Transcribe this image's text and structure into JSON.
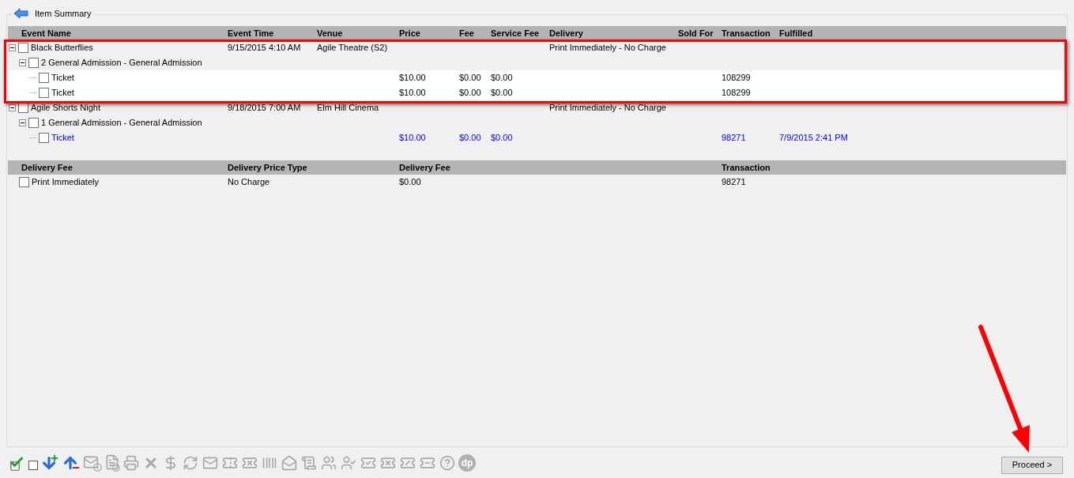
{
  "title": "Item Summary",
  "items_table": {
    "columns": [
      "Event Name",
      "Event Time",
      "Venue",
      "Price",
      "Fee",
      "Service Fee",
      "Delivery",
      "Sold For",
      "Transaction",
      "Fulfilled"
    ],
    "rows": [
      {
        "kind": "event",
        "name": "Black Butterflies",
        "checked": false,
        "expanded": true,
        "event_time": "9/15/2015 4:10 AM",
        "venue": "Agile Theatre (S2)",
        "delivery": "Print Immediately - No Charge",
        "children": [
          {
            "kind": "group",
            "name": "2 General Admission - General Admission",
            "checked": false,
            "expanded": true,
            "children": [
              {
                "kind": "ticket",
                "name": "Ticket",
                "checked": false,
                "fulfilled": false,
                "price": "$10.00",
                "fee": "$0.00",
                "service_fee": "$0.00",
                "transaction": "108299"
              },
              {
                "kind": "ticket",
                "name": "Ticket",
                "checked": false,
                "fulfilled": false,
                "price": "$10.00",
                "fee": "$0.00",
                "service_fee": "$0.00",
                "transaction": "108299"
              }
            ]
          }
        ]
      },
      {
        "kind": "event",
        "name": "Agile Shorts Night",
        "checked": false,
        "expanded": true,
        "event_time": "9/18/2015 7:00 AM",
        "venue": "Elm Hill Cinema",
        "delivery": "Print Immediately - No Charge",
        "children": [
          {
            "kind": "group",
            "name": "1 General Admission - General Admission",
            "checked": false,
            "expanded": true,
            "children": [
              {
                "kind": "ticket",
                "name": "Ticket",
                "checked": false,
                "fulfilled": true,
                "price": "$10.00",
                "fee": "$0.00",
                "service_fee": "$0.00",
                "transaction": "98271",
                "fulfilled_time": "7/9/2015 2:41 PM"
              }
            ]
          }
        ]
      }
    ]
  },
  "delivery_table": {
    "columns": [
      "Delivery Fee",
      "Delivery Price Type",
      "Delivery Fee",
      "Transaction"
    ],
    "rows": [
      {
        "name": "Print Immediately",
        "checked": false,
        "price_type": "No Charge",
        "fee": "$0.00",
        "transaction": "98271"
      }
    ]
  },
  "toolbar": [
    {
      "kind": "check-all",
      "disabled": false
    },
    {
      "kind": "uncheck-all",
      "disabled": false
    },
    {
      "kind": "add-down",
      "disabled": false
    },
    {
      "kind": "remove-up",
      "disabled": false
    },
    {
      "kind": "mail-info",
      "disabled": true
    },
    {
      "kind": "doc-info",
      "disabled": true
    },
    {
      "kind": "print",
      "disabled": true
    },
    {
      "kind": "delete",
      "disabled": true
    },
    {
      "kind": "dollar",
      "disabled": true
    },
    {
      "kind": "exchange",
      "disabled": true
    },
    {
      "kind": "mail",
      "disabled": true
    },
    {
      "kind": "ticket",
      "disabled": true
    },
    {
      "kind": "ticket-x",
      "disabled": true
    },
    {
      "kind": "barcode",
      "disabled": true
    },
    {
      "kind": "mail-open",
      "disabled": true
    },
    {
      "kind": "scroll",
      "disabled": true
    },
    {
      "kind": "users",
      "disabled": true
    },
    {
      "kind": "user-check",
      "disabled": true
    },
    {
      "kind": "ticket-forward",
      "disabled": true
    },
    {
      "kind": "ticket-x",
      "disabled": true
    },
    {
      "kind": "ticket-search",
      "disabled": true
    },
    {
      "kind": "ticket-info",
      "disabled": true
    },
    {
      "kind": "help",
      "disabled": true
    },
    {
      "kind": "logo",
      "disabled": true,
      "label": "dp"
    }
  ],
  "proceed_button": "Proceed >"
}
